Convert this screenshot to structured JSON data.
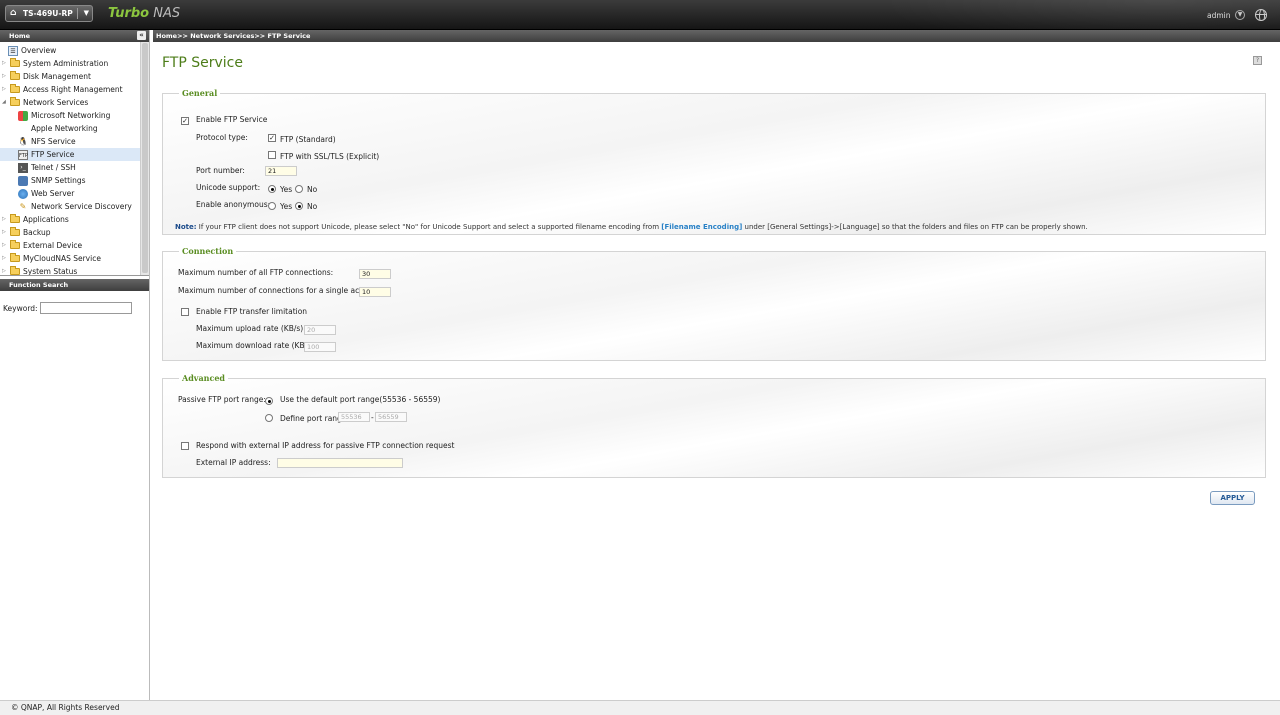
{
  "topbar": {
    "model": "TS-469U-RP",
    "brand_1": "Turbo",
    "brand_2": "NAS",
    "user": "admin"
  },
  "sidebar": {
    "header": "Home",
    "items": [
      {
        "label": "Overview",
        "icon": "overview-icon"
      },
      {
        "label": "System Administration",
        "icon": "folder-icon"
      },
      {
        "label": "Disk Management",
        "icon": "folder-icon"
      },
      {
        "label": "Access Right Management",
        "icon": "folder-icon"
      },
      {
        "label": "Network Services",
        "icon": "folder-open-icon"
      },
      {
        "label": "Microsoft Networking",
        "icon": "windows-icon"
      },
      {
        "label": "Apple Networking",
        "icon": "apple-icon"
      },
      {
        "label": "NFS Service",
        "icon": "linux-icon"
      },
      {
        "label": "FTP Service",
        "icon": "ftp-icon"
      },
      {
        "label": "Telnet / SSH",
        "icon": "terminal-icon"
      },
      {
        "label": "SNMP Settings",
        "icon": "snmp-icon"
      },
      {
        "label": "Web Server",
        "icon": "globe-icon"
      },
      {
        "label": "Network Service Discovery",
        "icon": "discovery-icon"
      },
      {
        "label": "Applications",
        "icon": "folder-icon"
      },
      {
        "label": "Backup",
        "icon": "folder-icon"
      },
      {
        "label": "External Device",
        "icon": "folder-icon"
      },
      {
        "label": "MyCloudNAS Service",
        "icon": "folder-icon"
      },
      {
        "label": "System Status",
        "icon": "folder-icon"
      }
    ],
    "function_search": "Function Search",
    "keyword_label": "Keyword:"
  },
  "main": {
    "breadcrumb": "Home>> Network Services>> FTP Service",
    "title": "FTP Service",
    "general": {
      "legend": "General",
      "enable_ftp": "Enable FTP Service",
      "protocol_label": "Protocol type:",
      "ftp_standard": "FTP (Standard)",
      "ftp_ssl": "FTP with SSL/TLS (Explicit)",
      "port_label": "Port number:",
      "port_value": "21",
      "unicode_label": "Unicode support:",
      "anonymous_label": "Enable anonymous:",
      "yes": "Yes",
      "no": "No",
      "note_prefix": "Note:",
      "note_1": " If your FTP client does not support Unicode, please select \"No\" for Unicode Support and select a supported filename encoding from ",
      "note_link": "[Filename Encoding]",
      "note_2": " under [General Settings]->[Language] so that the folders and files on FTP can be properly shown."
    },
    "connection": {
      "legend": "Connection",
      "max_all_label": "Maximum number of all FTP connections:",
      "max_all_value": "30",
      "max_single_label": "Maximum number of connections for a single account:",
      "max_single_value": "10",
      "enable_limit": "Enable FTP transfer limitation",
      "upload_label": "Maximum upload rate (KB/s):",
      "upload_value": "20",
      "download_label": "Maximum download rate (KB/s):",
      "download_value": "100"
    },
    "advanced": {
      "legend": "Advanced",
      "passive_label": "Passive FTP port range:",
      "default_range": "Use the default port range(55536 - 56559)",
      "define_range": "Define port range:",
      "range_from": "55536",
      "range_sep": "-",
      "range_to": "56559",
      "respond_external": "Respond with external IP address for passive FTP connection request",
      "external_ip_label": "External IP address:",
      "external_ip_value": ""
    },
    "apply": "APPLY"
  },
  "footer": "© QNAP, All Rights Reserved"
}
